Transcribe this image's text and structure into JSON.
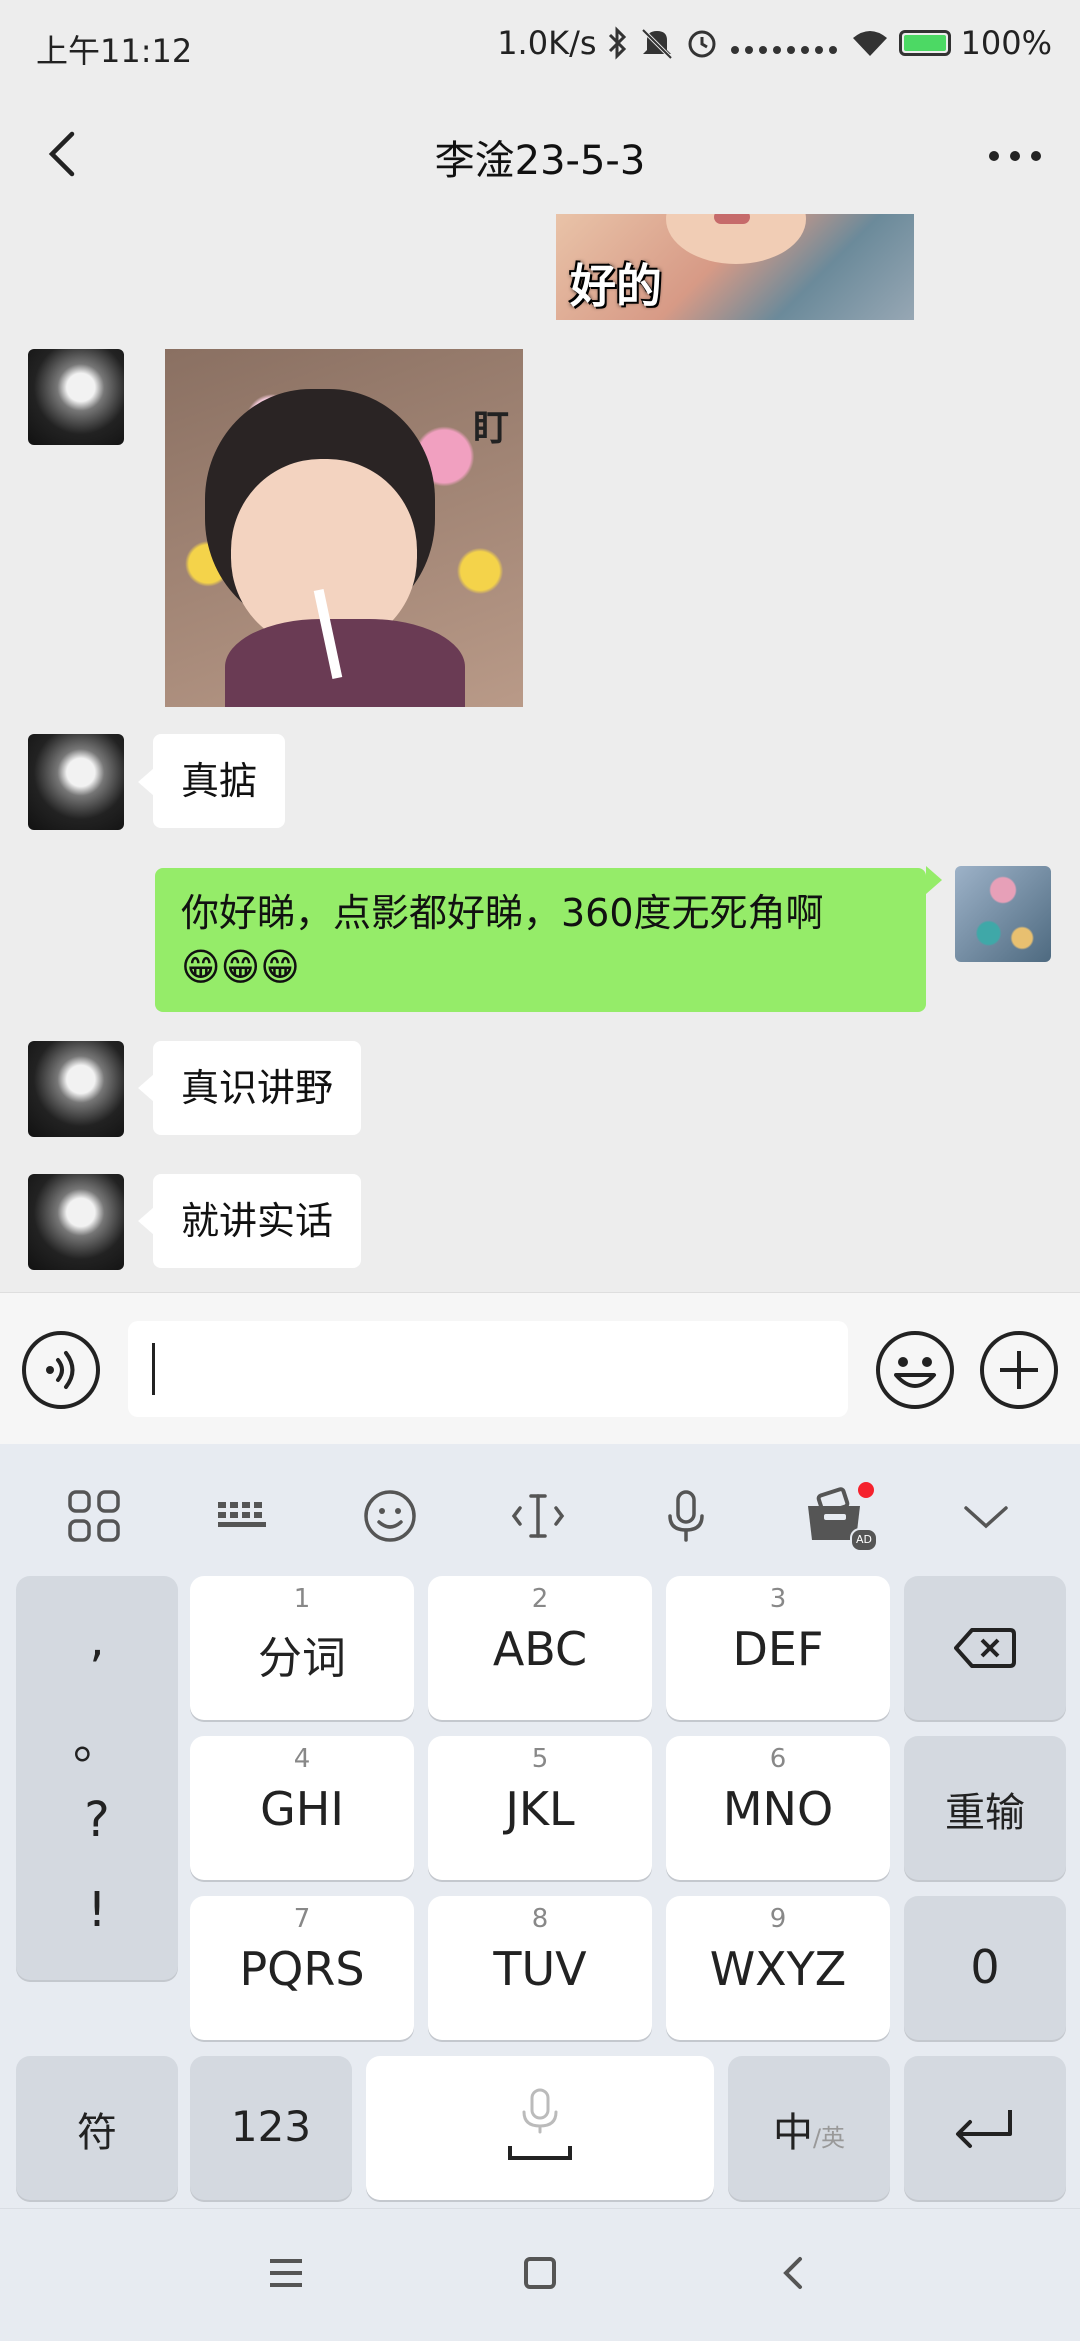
{
  "status_bar": {
    "time": "上午11:12",
    "network_speed": "1.0K/s",
    "battery": "100%",
    "icons": [
      "bluetooth-icon",
      "mute-icon",
      "alarm-icon",
      "signal-dots-icon",
      "wifi-icon",
      "battery-icon"
    ]
  },
  "header": {
    "title": "李淦23-5-3",
    "back_icon": "chevron-left-icon",
    "more_icon": "more-dots-icon"
  },
  "messages": [
    {
      "side": "right",
      "type": "sticker",
      "caption": "好的"
    },
    {
      "side": "left",
      "type": "sticker",
      "caption": "盯"
    },
    {
      "side": "left",
      "type": "text",
      "text": "真掂"
    },
    {
      "side": "right",
      "type": "text",
      "text": "你好睇，点影都好睇，360度无死角啊",
      "emoji": "😁😁😁"
    },
    {
      "side": "left",
      "type": "text",
      "text": "真识讲野"
    },
    {
      "side": "left",
      "type": "text",
      "text": "就讲实话"
    }
  ],
  "input_bar": {
    "voice_icon": "voice-icon",
    "placeholder": "",
    "emoji_icon": "emoji-icon",
    "plus_icon": "plus-icon"
  },
  "keyboard": {
    "toolbar": [
      "apps-grid-icon",
      "keyboard-icon",
      "emoji-face-icon",
      "cursor-icon",
      "microphone-icon",
      "toolbox-icon",
      "collapse-chevron-icon"
    ],
    "punct": [
      ",",
      "。",
      "?",
      "!"
    ],
    "keys": [
      {
        "num": "1",
        "label": "分词"
      },
      {
        "num": "2",
        "label": "ABC"
      },
      {
        "num": "3",
        "label": "DEF"
      },
      {
        "num": "4",
        "label": "GHI"
      },
      {
        "num": "5",
        "label": "JKL"
      },
      {
        "num": "6",
        "label": "MNO"
      },
      {
        "num": "7",
        "label": "PQRS"
      },
      {
        "num": "8",
        "label": "TUV"
      },
      {
        "num": "9",
        "label": "WXYZ"
      }
    ],
    "backspace_icon": "backspace-icon",
    "reenter": "重输",
    "zero": "0",
    "symbols": "符",
    "numbers": "123",
    "lang_main": "中",
    "lang_sub": "/英",
    "enter_icon": "enter-icon",
    "ad_badge": "AD"
  },
  "nav_bar": {
    "icons": [
      "menu-icon",
      "home-square-icon",
      "back-icon"
    ]
  },
  "colors": {
    "background": "#ededed",
    "bubble_out": "#95ec69",
    "bubble_in": "#ffffff",
    "keyboard_bg": "#e7ebf1",
    "notification_dot": "#f5222d"
  }
}
